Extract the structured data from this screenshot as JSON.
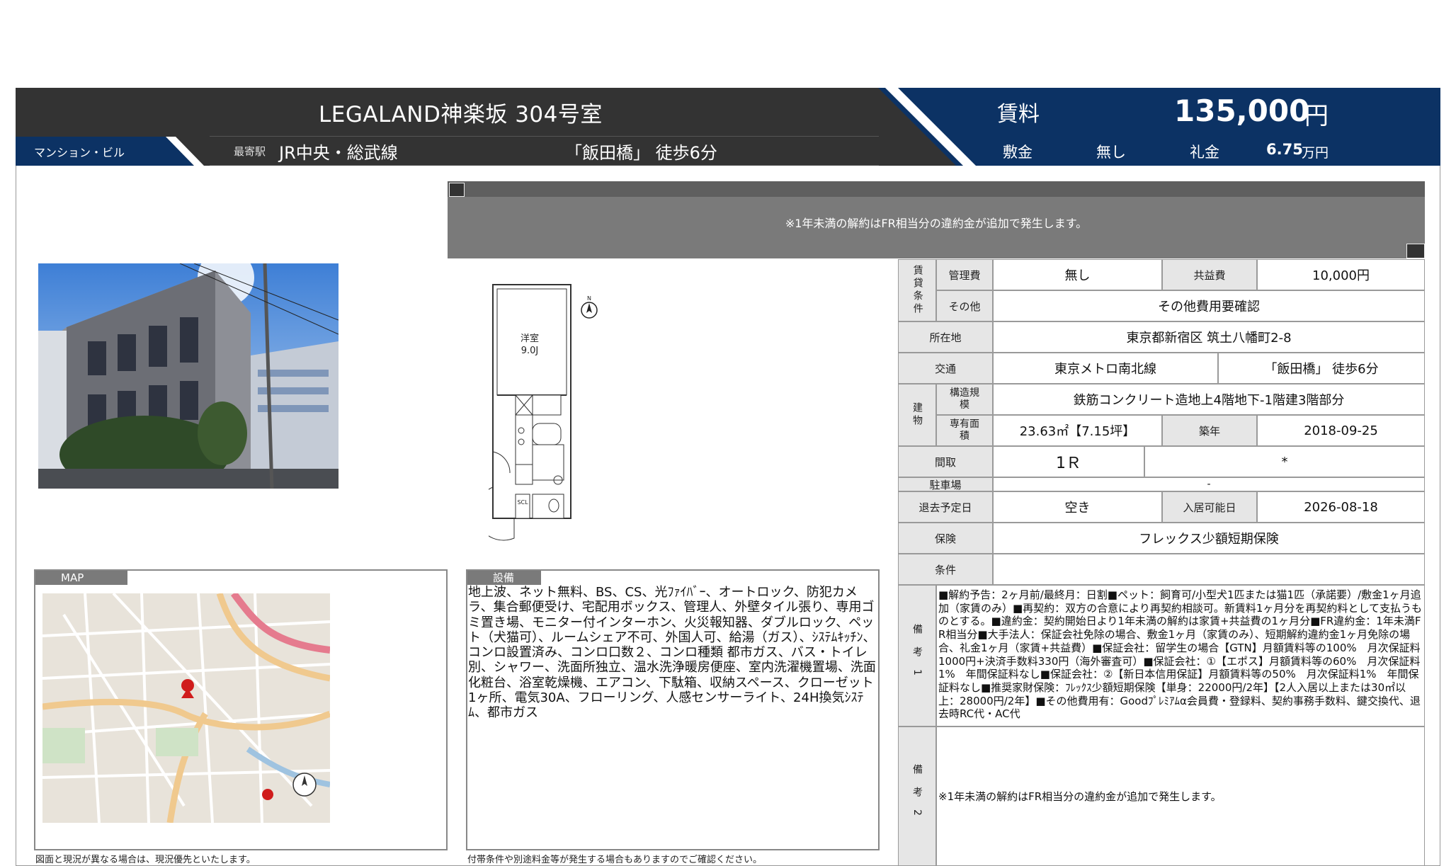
{
  "header": {
    "title": "LEGALAND神楽坂 304号室",
    "property_type": "マンション・ビル",
    "station_label": "最寄駅",
    "station_line": "JR中央・総武線",
    "station_walk": "「飯田橋」 徒歩6分",
    "rent_label": "賃料",
    "rent_value": "135,000",
    "rent_unit": "円",
    "deposit_label": "敷金",
    "deposit_value": "無し",
    "key_money_label": "礼金",
    "key_money_value": "6.75",
    "key_money_unit": "万円"
  },
  "notice": {
    "text": "※1年未満の解約はFR相当分の違約金が追加で発生します。"
  },
  "floorplan": {
    "room_label": "洋室",
    "room_size": "9.0J",
    "north": "N",
    "closet": "SCL"
  },
  "info_table": {
    "rent_terms_label": "賃貸条件",
    "management_fee_label": "管理費",
    "management_fee_value": "無し",
    "common_fee_label": "共益費",
    "common_fee_value": "10,000円",
    "other_label": "その他",
    "other_value": "その他費用要確認",
    "address_label": "所在地",
    "address_value": "東京都新宿区 筑土八幡町2-8",
    "transport_label": "交通",
    "transport_line": "東京メトロ南北線",
    "transport_walk": "「飯田橋」 徒歩6分",
    "building_label": "建物",
    "structure_label": "構造規模",
    "structure_value": "鉄筋コンクリート造地上4階地下-1階建3階部分",
    "area_label": "専有面積",
    "area_value": "23.63㎡【7.15坪】",
    "built_label": "築年",
    "built_value": "2018-09-25",
    "layout_label": "間取",
    "layout_value": "1Ｒ",
    "layout_extra": "*",
    "parking_label": "駐車場",
    "parking_value": "-",
    "vacate_label": "退去予定日",
    "vacate_value": "空き",
    "movein_label": "入居可能日",
    "movein_value": "2026-08-18",
    "insurance_label": "保険",
    "insurance_value": "フレックス少額短期保険",
    "conditions_label": "条件",
    "conditions_value": "",
    "remarks1_label": "備考1",
    "remarks1_value": "■解約予告：2ヶ月前/最終月：日割■ペット：飼育可/小型犬1匹または猫1匹（承諾要）/敷金1ヶ月追加（家賃のみ）■再契約：双方の合意により再契約相談可。新賃料1ヶ月分を再契約料として支払うものとする。■違約金：契約開始日より1年未満の解約は家賃+共益費の1ヶ月分■FR違約金：1年未満FR相当分■大手法人：保証会社免除の場合、敷金1ヶ月（家賃のみ）、短期解約違約金1ヶ月免除の場合、礼金1ヶ月（家賃+共益費）■保証会社：留学生の場合【GTN】月額賃料等の100%　月次保証料1000円+決済手数料330円（海外審査可）■保証会社：①【エポス】月額賃料等の60%　月次保証料1%　年間保証料なし■保証会社：②【新日本信用保証】月額賃料等の50%　月次保証料1%　年間保証料なし■推奨家財保険：ﾌﾚｯｸｽ少額短期保険【単身：22000円/2年】【2人入居以上または30㎡以上：28000円/2年】■その他費用有：Goodﾌﾟﾚﾐｱﾑα会員費・登録料、契約事務手数料、鍵交換代、退去時RC代・AC代",
    "remarks2_label": "備考2",
    "remarks2_value": "※1年未満の解約はFR相当分の違約金が追加で発生します。"
  },
  "map": {
    "tab_label": "MAP",
    "footnote": "図面と現況が異なる場合は、現況優先といたします。"
  },
  "equipment": {
    "tab_label": "設備",
    "text": "地上波、ネット無料、BS、CS、光ﾌｧｲﾊﾞｰ、オートロック、防犯カメラ、集合郵便受け、宅配用ボックス、管理人、外壁タイル張り、専用ゴミ置き場、モニター付インターホン、火災報知器、ダブルロック、ペット（犬猫可）、ルームシェア不可、外国人可、給湯（ガス）、ｼｽﾃﾑｷｯﾁﾝ、コンロ設置済み、コンロ口数２、コンロ種類 都市ガス、バス・トイレ別、シャワー、洗面所独立、温水洗浄暖房便座、室内洗濯機置場、洗面化粧台、浴室乾燥機、エアコン、下駄箱、収納スペース、クローゼット1ヶ所、電気30A、フローリング、人感センサーライト、24H換気ｼｽﾃﾑ、都市ガス",
    "footnote": "付帯条件や別途料金等が発生する場合もありますのでご確認ください。"
  },
  "colors": {
    "header_dark": "#333333",
    "header_blue": "#0c3264",
    "notice_gray": "#7a7a7a",
    "label_gray": "#e6e6e6"
  }
}
